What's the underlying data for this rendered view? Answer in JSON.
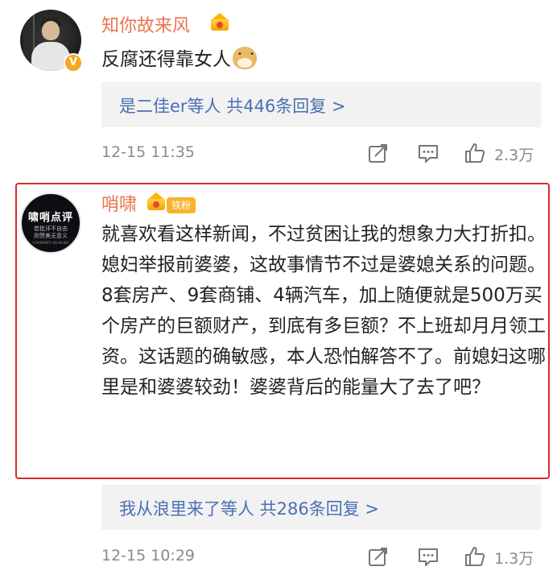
{
  "comments": [
    {
      "username": "知你故来风",
      "text": "反腐还得靠女人",
      "replies": "是二佳er等人 共446条回复 >",
      "time": "12-15 11:35",
      "likes": "2.3万"
    },
    {
      "username": "哨啸",
      "fan_badge": "铁粉",
      "avatar_text": {
        "title": "啸哨点评",
        "line1": "若批评不自由",
        "line2": "则赞美无意义",
        "line3": "COMMENTS ON WEIBO"
      },
      "text": "就喜欢看这样新闻，不过贫困让我的想象力大打折扣。媳妇举报前婆婆，这故事情节不过是婆媳关系的问题。8套房产、9套商铺、4辆汽车，加上随便就是500万买个房产的巨额财产，到底有多巨额？不上班却月月领工资。这话题的确敏感，本人恐怕解答不了。前媳妇这哪里是和婆婆较劲！婆婆背后的能量大了去了吧？",
      "replies": "我从浪里来了等人 共286条回复 >",
      "time": "12-15 10:29",
      "likes": "1.3万"
    }
  ],
  "colors": {
    "username": "#eb7350",
    "link": "#4a6fb4",
    "meta": "#8a8a8a",
    "highlight_border": "#d62b2b"
  },
  "icons": [
    "verified-badge-icon",
    "crown-badge-icon",
    "doge-emoji-icon",
    "share-icon",
    "comment-icon",
    "like-icon"
  ]
}
